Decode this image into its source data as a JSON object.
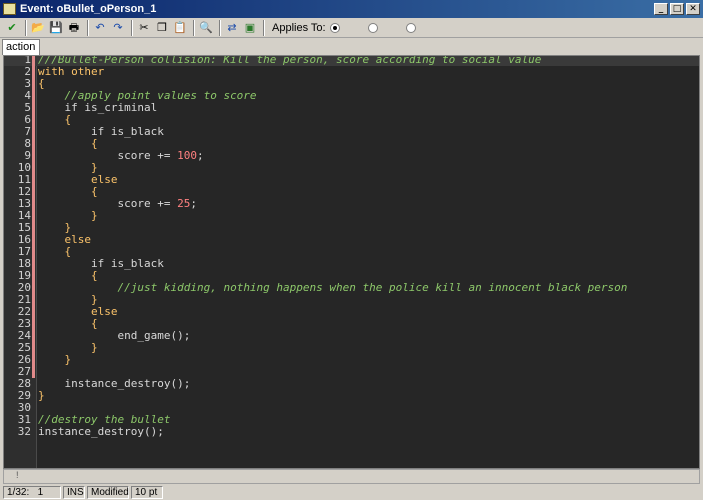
{
  "window": {
    "title": "Event: oBullet_oPerson_1",
    "controls": {
      "minimize": "_",
      "maximize": "□",
      "close": "✕"
    }
  },
  "toolbar": {
    "buttons": [
      {
        "name": "ok-check-icon",
        "glyph": "✔",
        "color": "#1a8a1a"
      },
      {
        "name": "open-folder-icon",
        "glyph": "📂",
        "color": "#b08a20"
      },
      {
        "name": "save-icon",
        "glyph": "💾",
        "color": "#2a4a9a"
      },
      {
        "name": "print-icon",
        "glyph": "🖶",
        "color": "#404040"
      },
      {
        "name": "undo-icon",
        "glyph": "↶",
        "color": "#1a4aaa"
      },
      {
        "name": "redo-icon",
        "glyph": "↷",
        "color": "#1a4aaa"
      },
      {
        "name": "cut-icon",
        "glyph": "✂",
        "color": "#303030"
      },
      {
        "name": "copy-icon",
        "glyph": "❐",
        "color": "#303030"
      },
      {
        "name": "paste-icon",
        "glyph": "📋",
        "color": "#705020"
      },
      {
        "name": "search-icon",
        "glyph": "🔍",
        "color": "#303030"
      },
      {
        "name": "replace-icon",
        "glyph": "⇄",
        "color": "#1a4aaa"
      },
      {
        "name": "check-script-icon",
        "glyph": "▣",
        "color": "#2a7a2a"
      }
    ],
    "applies_to_label": "Applies To:",
    "radios": [
      {
        "name": "applies-self-radio",
        "label": "",
        "selected": true
      },
      {
        "name": "applies-other-radio",
        "label": "",
        "selected": false
      },
      {
        "name": "applies-object-radio",
        "label": "",
        "selected": false
      }
    ]
  },
  "tab": {
    "label": "action"
  },
  "editor": {
    "active_line": 1,
    "changed_lines": [
      1,
      2,
      3,
      4,
      5,
      6,
      7,
      8,
      9,
      10,
      11,
      12,
      13,
      14,
      15,
      16,
      17,
      18,
      19,
      20,
      21,
      22,
      23,
      24,
      25,
      26,
      27
    ],
    "lines": [
      [
        {
          "t": "///Bullet-Person collision: Kill the person, score according to social value",
          "c": "comment"
        }
      ],
      [
        {
          "t": "with other",
          "c": "kw"
        }
      ],
      [
        {
          "t": "{",
          "c": "kw"
        }
      ],
      [
        {
          "t": "    "
        },
        {
          "t": "//apply point values to score",
          "c": "comment"
        }
      ],
      [
        {
          "t": "    if is_criminal"
        }
      ],
      [
        {
          "t": "    {",
          "c": "kw"
        }
      ],
      [
        {
          "t": "        if is_black"
        }
      ],
      [
        {
          "t": "        {",
          "c": "kw"
        }
      ],
      [
        {
          "t": "            score += "
        },
        {
          "t": "100",
          "c": "num"
        },
        {
          "t": ";"
        }
      ],
      [
        {
          "t": "        }",
          "c": "kw"
        }
      ],
      [
        {
          "t": "        else",
          "c": "kw"
        }
      ],
      [
        {
          "t": "        {",
          "c": "kw"
        }
      ],
      [
        {
          "t": "            score += "
        },
        {
          "t": "25",
          "c": "num"
        },
        {
          "t": ";"
        }
      ],
      [
        {
          "t": "        }",
          "c": "kw"
        }
      ],
      [
        {
          "t": "    }",
          "c": "kw"
        }
      ],
      [
        {
          "t": "    else",
          "c": "kw"
        }
      ],
      [
        {
          "t": "    {",
          "c": "kw"
        }
      ],
      [
        {
          "t": "        if is_black"
        }
      ],
      [
        {
          "t": "        {",
          "c": "kw"
        }
      ],
      [
        {
          "t": "            "
        },
        {
          "t": "//just kidding, nothing happens when the police kill an innocent black person",
          "c": "comment"
        }
      ],
      [
        {
          "t": "        }",
          "c": "kw"
        }
      ],
      [
        {
          "t": "        else",
          "c": "kw"
        }
      ],
      [
        {
          "t": "        {",
          "c": "kw"
        }
      ],
      [
        {
          "t": "            end_game();"
        }
      ],
      [
        {
          "t": "        }",
          "c": "kw"
        }
      ],
      [
        {
          "t": "    }",
          "c": "kw"
        }
      ],
      [],
      [
        {
          "t": "    instance_destroy();"
        }
      ],
      [
        {
          "t": "}",
          "c": "kw"
        }
      ],
      [],
      [
        {
          "t": "//destroy the bullet",
          "c": "comment"
        }
      ],
      [
        {
          "t": "instance_destroy();"
        }
      ]
    ]
  },
  "bottom_panel": {
    "mark": "!"
  },
  "status": {
    "position": "1/32:   1",
    "mode": "INS",
    "modified": "Modified",
    "font_size": "10 pt"
  },
  "colors": {
    "editor_bg": "#262626",
    "comment": "#8dc86a",
    "keyword": "#fbc36a",
    "number": "#ff8080",
    "change_marker": "#e08a8a"
  }
}
